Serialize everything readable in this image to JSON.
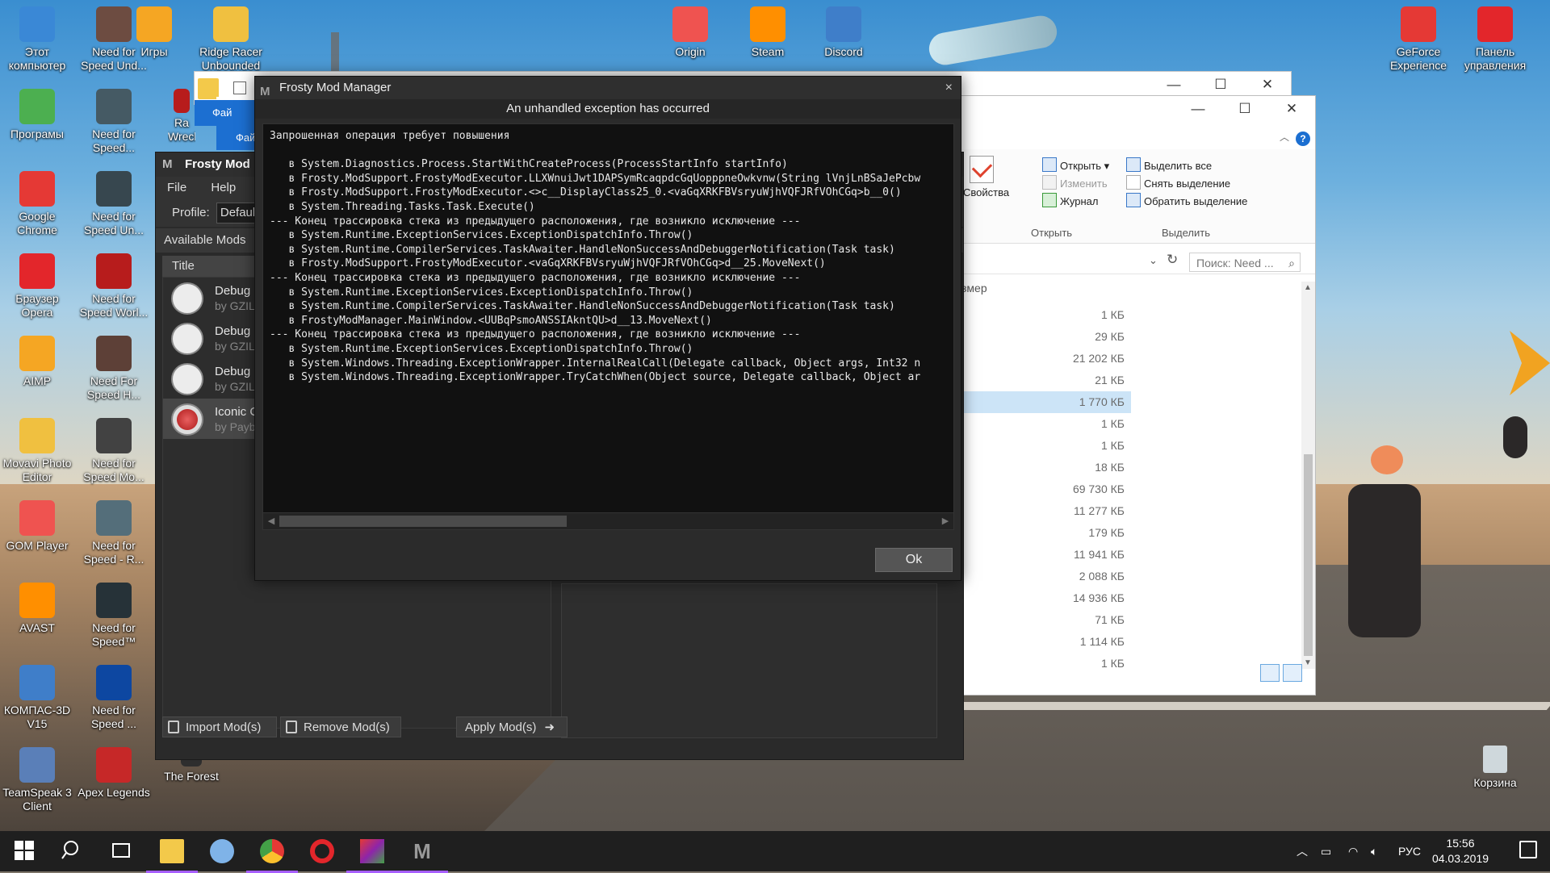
{
  "desktop": {
    "icons_left": [
      {
        "label": "Этот компьютер",
        "icon": "computer-icon"
      },
      {
        "label": "Програмы",
        "icon": "programs-icon"
      },
      {
        "label": "Google Chrome",
        "icon": "chrome-icon"
      },
      {
        "label": "Браузер Opera",
        "icon": "opera-icon"
      },
      {
        "label": "AIMP",
        "icon": "aimp-icon"
      },
      {
        "label": "Movavi Photo Editor",
        "icon": "movavi-icon"
      },
      {
        "label": "GOM Player",
        "icon": "gom-icon"
      },
      {
        "label": "AVAST",
        "icon": "avast-icon"
      },
      {
        "label": "КОМПАС-3D V15",
        "icon": "kompas-icon"
      },
      {
        "label": "TeamSpeak 3 Client",
        "icon": "teamspeak-icon"
      }
    ],
    "icons_second": [
      {
        "label": "Need for Speed Und...",
        "icon": "nfs-icon"
      },
      {
        "label": "Need for Speed...",
        "icon": "nfs-icon"
      },
      {
        "label": "Need for Speed Un...",
        "icon": "nfs-icon"
      },
      {
        "label": "Need for Speed Worl...",
        "icon": "nfs-icon"
      },
      {
        "label": "Need For Speed H...",
        "icon": "nfs-icon"
      },
      {
        "label": "Need for Speed Mo...",
        "icon": "nfs-icon"
      },
      {
        "label": "Need for Speed - R...",
        "icon": "nfs-icon"
      },
      {
        "label": "Need for Speed™",
        "icon": "nfs-icon"
      },
      {
        "label": "Need for Speed ...",
        "icon": "nfs-icon"
      },
      {
        "label": "Apex Legends",
        "icon": "apex-icon"
      }
    ],
    "icons_top": [
      {
        "label": "Игры",
        "icon": "games-icon"
      },
      {
        "label": "Ridge Racer Unbounded",
        "icon": "ridge-racer-icon"
      },
      {
        "label": "Origin",
        "icon": "origin-icon"
      },
      {
        "label": "Steam",
        "icon": "steam-icon"
      },
      {
        "label": "Discord",
        "icon": "discord-icon"
      }
    ],
    "icons_right": [
      {
        "label": "GeForce Experience",
        "icon": "geforce-icon"
      },
      {
        "label": "Панель управления",
        "icon": "control-panel-icon"
      }
    ],
    "partial_icon": "Ra Wreck",
    "forest_label": "The Forest",
    "recycle_label": "Корзина"
  },
  "explorer": {
    "ribbon": {
      "props_label": "Свойства",
      "open_label": "Открыть",
      "edit_label": "Изменить",
      "journal_label": "Журнал",
      "select_all": "Выделить все",
      "deselect": "Снять выделение",
      "invert": "Обратить выделение",
      "group_open": "Открыть",
      "group_select": "Выделить"
    },
    "search_placeholder": "Поиск: Need ...",
    "size_header": "змер",
    "sizes": [
      "1 КБ",
      "29 КБ",
      "21 202 КБ",
      "21 КБ",
      "1 770 КБ",
      "1 КБ",
      "1 КБ",
      "18 КБ",
      "69 730 КБ",
      "11 277 КБ",
      "179 КБ",
      "11 941 КБ",
      "2 088 КБ",
      "14 936 КБ",
      "71 КБ",
      "1 114 КБ",
      "1 КБ"
    ],
    "selected_index": 4,
    "back_tab": "Фай"
  },
  "frosty": {
    "title": "Frosty Mod I",
    "menu": [
      "File",
      "Help"
    ],
    "profile_label": "Profile:",
    "profile_value": "Defaul",
    "available_mods": "Available Mods",
    "column_title": "Title",
    "mods": [
      {
        "name": "Debug S",
        "author": "by GZILL"
      },
      {
        "name": "Debug S",
        "author": "by GZILL"
      },
      {
        "name": "Debug S",
        "author": "by GZILL"
      },
      {
        "name": "Iconic Ca",
        "author": "by Payba"
      }
    ],
    "import_btn": "Import Mod(s)",
    "remove_btn": "Remove Mod(s)",
    "apply_btn": "Apply Mod(s)"
  },
  "dialog": {
    "title": "Frosty Mod Manager",
    "header": "An unhandled exception has occurred",
    "trace": [
      "Запрошенная операция требует повышения",
      "",
      "   в System.Diagnostics.Process.StartWithCreateProcess(ProcessStartInfo startInfo)",
      "   в Frosty.ModSupport.FrostyModExecutor.LLXWnuiJwt1DAPSymRcaqpdcGqUopppneOwkvnw(String lVnjLnBSaJePcbw",
      "   в Frosty.ModSupport.FrostyModExecutor.<>c__DisplayClass25_0.<vaGqXRKFBVsryuWjhVQFJRfVOhCGq>b__0()",
      "   в System.Threading.Tasks.Task.Execute()",
      "--- Конец трассировка стека из предыдущего расположения, где возникло исключение ---",
      "   в System.Runtime.ExceptionServices.ExceptionDispatchInfo.Throw()",
      "   в System.Runtime.CompilerServices.TaskAwaiter.HandleNonSuccessAndDebuggerNotification(Task task)",
      "   в Frosty.ModSupport.FrostyModExecutor.<vaGqXRKFBVsryuWjhVQFJRfVOhCGq>d__25.MoveNext()",
      "--- Конец трассировка стека из предыдущего расположения, где возникло исключение ---",
      "   в System.Runtime.ExceptionServices.ExceptionDispatchInfo.Throw()",
      "   в System.Runtime.CompilerServices.TaskAwaiter.HandleNonSuccessAndDebuggerNotification(Task task)",
      "   в FrostyModManager.MainWindow.<UUBqPsmoANSSIAkntQU>d__13.MoveNext()",
      "--- Конец трассировка стека из предыдущего расположения, где возникло исключение ---",
      "   в System.Runtime.ExceptionServices.ExceptionDispatchInfo.Throw()",
      "   в System.Windows.Threading.ExceptionWrapper.InternalRealCall(Delegate callback, Object args, Int32 n",
      "   в System.Windows.Threading.ExceptionWrapper.TryCatchWhen(Object source, Delegate callback, Object ar"
    ],
    "ok_label": "Ok"
  },
  "taskbar": {
    "lang": "РУС",
    "time": "15:56",
    "date": "04.03.2019"
  },
  "colors": {
    "accent": "#a65eff",
    "dialog_bg": "#2b2b2b",
    "trace_bg": "#111111",
    "explorer_selection": "#cce4f7"
  }
}
